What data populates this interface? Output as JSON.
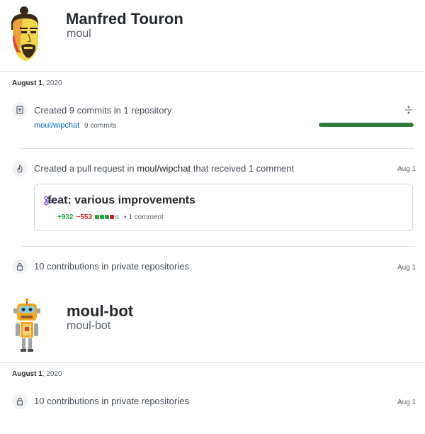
{
  "user1": {
    "name": "Manfred Touron",
    "login": "moul"
  },
  "section1": {
    "date": {
      "day": "August 1",
      "year": ", 2020"
    },
    "commits": {
      "text": "Created 9 commits in 1 repository",
      "repo": "moul/wipchat",
      "count": "9 commits",
      "progress": 1.0,
      "bar_color": "#2d7a3a"
    },
    "pull_request": {
      "prefix": "Created a pull request in ",
      "repo": "moul/wipchat",
      "suffix": " that received 1 comment",
      "date": "Aug 1",
      "title": "feat: various improvements",
      "additions": "+932",
      "deletions": "−553",
      "comments": "• 1 comment"
    },
    "private": {
      "text": "10 contributions in private repositories",
      "date": "Aug 1"
    }
  },
  "user2": {
    "name": "moul-bot",
    "login": "moul-bot"
  },
  "section2": {
    "date": {
      "day": "August 1",
      "year": ", 2020"
    },
    "private": {
      "text": "10 contributions in private repositories",
      "date": "Aug 1"
    }
  }
}
